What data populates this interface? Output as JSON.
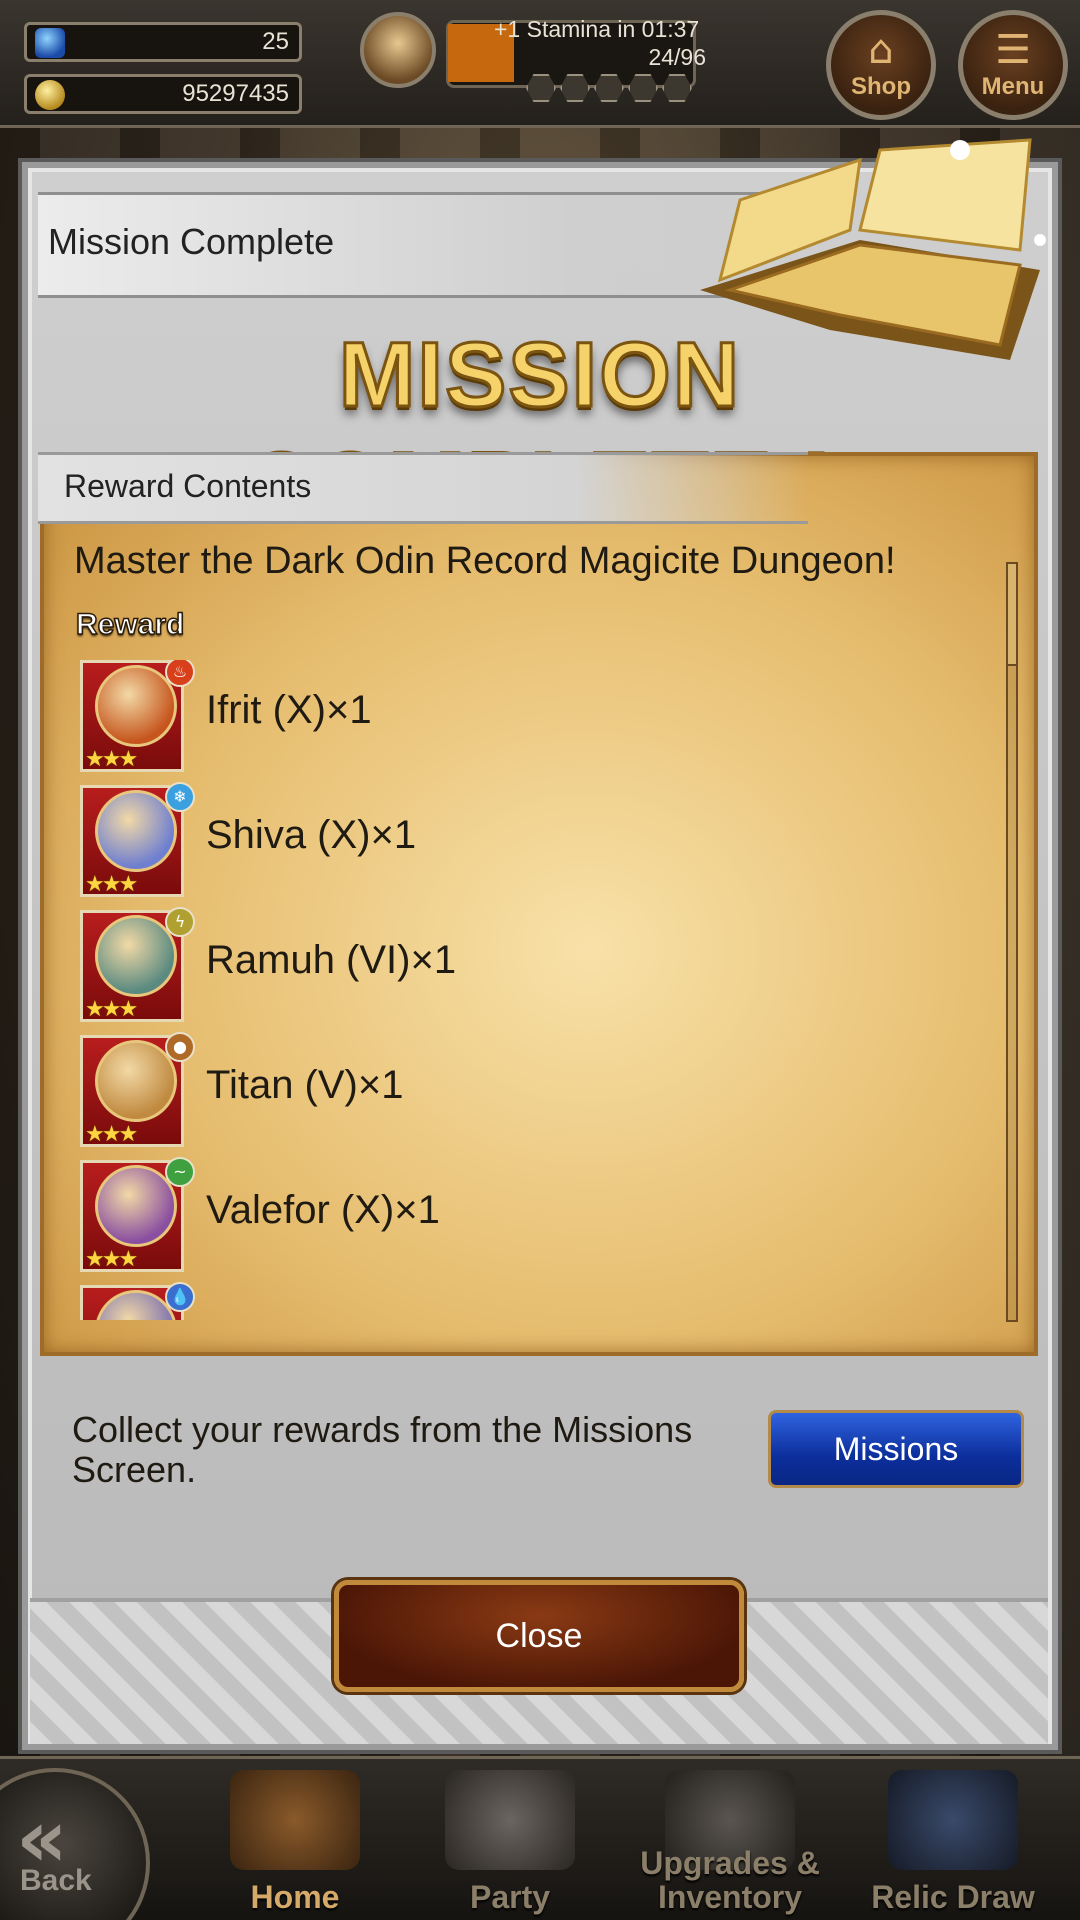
{
  "hud": {
    "gems": "25",
    "gil": "95297435",
    "stamina_timer": "+1 Stamina in 01:37",
    "stamina_count": "24/96",
    "shop_label": "Shop",
    "menu_label": "Menu"
  },
  "modal": {
    "header_title": "Mission Complete",
    "banner_text": "MISSION COMPLETE !",
    "reward_contents_label": "Reward Contents",
    "mission_title": "Master the Dark Odin Record Magicite Dungeon!",
    "reward_label": "Reward",
    "rewards": [
      {
        "name": "Ifrit (X)×1",
        "element": "fire-icon",
        "element_color": "#d8401c",
        "orb_color": "#c6561e",
        "stars": "★★★"
      },
      {
        "name": "Shiva (X)×1",
        "element": "ice-icon",
        "element_color": "#3aa0e0",
        "orb_color": "#6f7fd0",
        "stars": "★★★"
      },
      {
        "name": "Ramuh (VI)×1",
        "element": "lightning-icon",
        "element_color": "#b0a030",
        "orb_color": "#5a8a80",
        "stars": "★★★"
      },
      {
        "name": "Titan (V)×1",
        "element": "earth-icon",
        "element_color": "#b06a28",
        "orb_color": "#c08a40",
        "stars": "★★★"
      },
      {
        "name": "Valefor (X)×1",
        "element": "wind-icon",
        "element_color": "#3fa040",
        "orb_color": "#8a4fa0",
        "stars": "★★★"
      },
      {
        "name": "",
        "element": "water-icon",
        "element_color": "#3a6fd0",
        "orb_color": "#7a6fb0",
        "stars": ""
      }
    ],
    "collect_text": "Collect your rewards from the Missions Screen.",
    "missions_button": "Missions",
    "close_button": "Close"
  },
  "nav": {
    "back": "Back",
    "home": "Home",
    "party": "Party",
    "upgrades_inventory": "Upgrades & Inventory",
    "relic_draw": "Relic Draw"
  },
  "colors": {
    "accent_gold": "#f5d36a",
    "missions_blue": "#0c2f9c",
    "close_brown": "#4b1606"
  }
}
